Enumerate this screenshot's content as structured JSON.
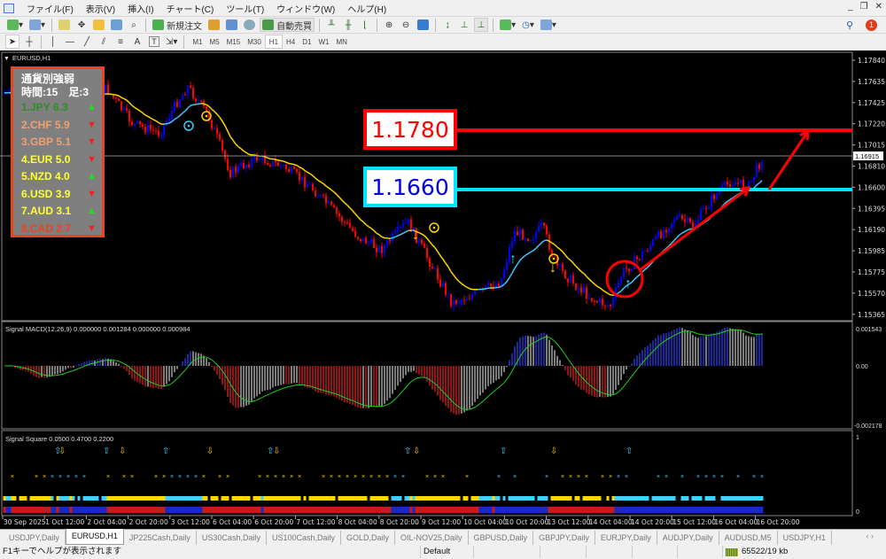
{
  "menu": [
    "ファイル(F)",
    "表示(V)",
    "挿入(I)",
    "チャート(C)",
    "ツール(T)",
    "ウィンドウ(W)",
    "ヘルプ(H)"
  ],
  "toolbar": {
    "new_order": "新規注文",
    "auto_trade": "自動売買",
    "notification_count": "1"
  },
  "drawing_tools": {
    "text_tool": "A",
    "label_tool": "T"
  },
  "timeframes": [
    "M1",
    "M5",
    "M15",
    "M30",
    "H1",
    "H4",
    "D1",
    "W1",
    "MN"
  ],
  "active_timeframe": "H1",
  "chart": {
    "symbol_title": "EURUSD,H1",
    "price_labels": [
      "1.17840",
      "1.17635",
      "1.17425",
      "1.17220",
      "1.17015",
      "1.16810",
      "1.16600",
      "1.16395",
      "1.16190",
      "1.15985",
      "1.15775",
      "1.15570",
      "1.15365"
    ],
    "current_price": "1.16915",
    "annotations": {
      "target": "1.1780",
      "support": "1.1660"
    },
    "colors": {
      "bull": "#0000ff",
      "bear": "#ff0000",
      "ma_up": "#40c8ff",
      "ma_down": "#ffd700",
      "target": "#ff0000",
      "support": "#00e5ff"
    }
  },
  "strength_panel": {
    "title": "通貨別強弱",
    "subtitle": "時間:15　足:3",
    "rows": [
      {
        "label": "1.JPY",
        "value": "6.3",
        "dir": "up",
        "color": "#2e8b2e"
      },
      {
        "label": "2.CHF",
        "value": "5.9",
        "dir": "down",
        "color": "#f0a070"
      },
      {
        "label": "3.GBP",
        "value": "5.1",
        "dir": "down",
        "color": "#f0a070"
      },
      {
        "label": "4.EUR",
        "value": "5.0",
        "dir": "down",
        "color": "#ffff33"
      },
      {
        "label": "5.NZD",
        "value": "4.0",
        "dir": "up",
        "color": "#ffff33"
      },
      {
        "label": "6.USD",
        "value": "3.9",
        "dir": "down",
        "color": "#ffff33"
      },
      {
        "label": "7.AUD",
        "value": "3.1",
        "dir": "up",
        "color": "#ffff33"
      },
      {
        "label": "8.CAD",
        "value": "2.7",
        "dir": "down",
        "color": "#e8461c"
      }
    ],
    "up_glyph": "▲",
    "down_glyph": "▼"
  },
  "macd": {
    "title": "Signal MACD(12,26,9) 0.000000 0.001284 0.000000 0.000984",
    "max_label": "0.001543",
    "zero_label": "0.00",
    "min_label": "-0.002178"
  },
  "signal_square": {
    "title": "Signal Square 0.0500 0.4700 0.2200",
    "max_label": "1",
    "min_label": "0"
  },
  "time_labels": [
    "30 Sep 2025",
    "1 Oct 12:00",
    "2 Oct 04:00",
    "2 Oct 20:00",
    "3 Oct 12:00",
    "6 Oct 04:00",
    "6 Oct 20:00",
    "7 Oct 12:00",
    "8 Oct 04:00",
    "8 Oct 20:00",
    "9 Oct 12:00",
    "10 Oct 04:00",
    "10 Oct 20:00",
    "13 Oct 12:00",
    "14 Oct 04:00",
    "14 Oct 20:00",
    "15 Oct 12:00",
    "16 Oct 04:00",
    "16 Oct 20:00"
  ],
  "tabs": [
    {
      "label": "USDJPY,Daily"
    },
    {
      "label": "EURUSD,H1",
      "active": true
    },
    {
      "label": "JP225Cash,Daily"
    },
    {
      "label": "US30Cash,Daily"
    },
    {
      "label": "US100Cash,Daily"
    },
    {
      "label": "GOLD,Daily"
    },
    {
      "label": "OIL-NOV25,Daily"
    },
    {
      "label": "GBPUSD,Daily"
    },
    {
      "label": "GBPJPY,Daily"
    },
    {
      "label": "EURJPY,Daily"
    },
    {
      "label": "AUDJPY,Daily"
    },
    {
      "label": "AUDUSD,M5"
    },
    {
      "label": "USDJPY,H1"
    }
  ],
  "status": {
    "help": "F1キーでヘルプが表示されます",
    "profile": "Default",
    "traffic": "65522/19 kb"
  }
}
